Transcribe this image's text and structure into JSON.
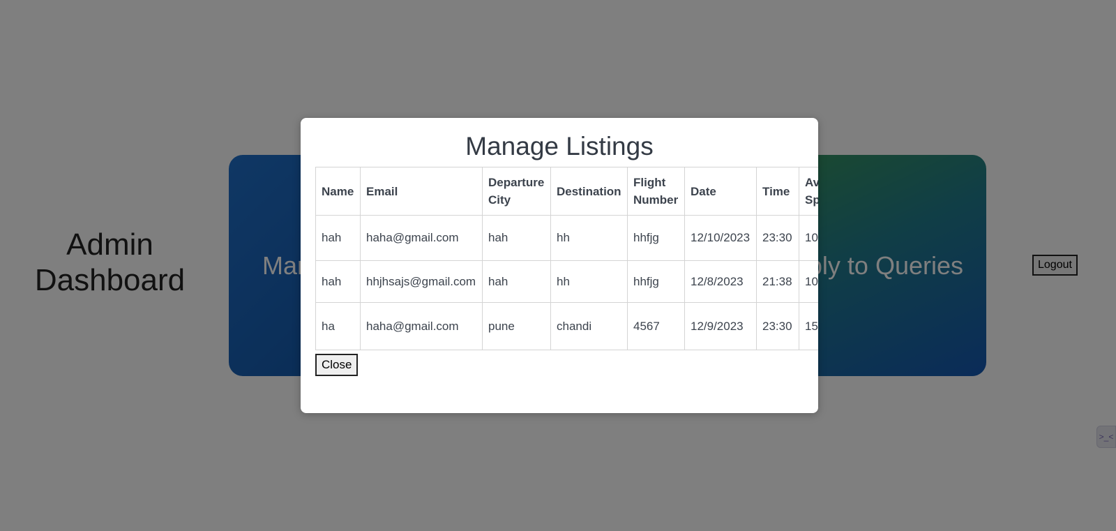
{
  "dashboard": {
    "title": "Admin Dashboard",
    "cards": [
      {
        "label": "Manage Listings"
      },
      {
        "label": "Reply to Queries"
      }
    ],
    "logout_label": "Logout"
  },
  "modal": {
    "title": "Manage Listings",
    "columns": [
      "Name",
      "Email",
      "Departure City",
      "Destination",
      "Flight Number",
      "Date",
      "Time",
      "Available Space"
    ],
    "rows": [
      [
        "hah",
        "haha@gmail.com",
        "hah",
        "hh",
        "hhfjg",
        "12/10/2023",
        "23:30",
        "10"
      ],
      [
        "hah",
        "hhjhsajs@gmail.com",
        "hah",
        "hh",
        "hhfjg",
        "12/8/2023",
        "21:38",
        "10"
      ],
      [
        "ha",
        "haha@gmail.com",
        "pune",
        "chandi",
        "4567",
        "12/9/2023",
        "23:30",
        "15"
      ]
    ],
    "close_label": "Close"
  },
  "colors": {
    "overlay": "rgba(0,0,0,0.5)",
    "card_left": "#1457a8",
    "card_right": "#217c8d"
  }
}
